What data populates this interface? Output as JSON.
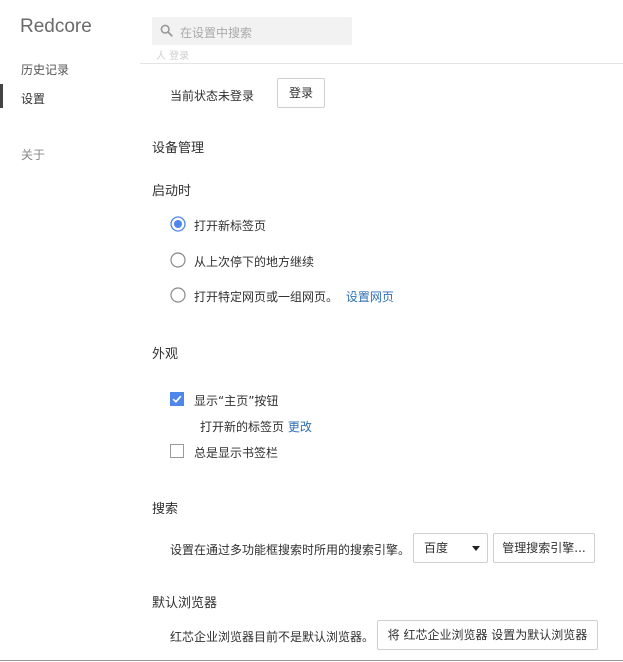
{
  "sidebar": {
    "brand": "Redcore",
    "items": [
      {
        "label": "历史记录"
      },
      {
        "label": "设置"
      },
      {
        "label": "关于"
      }
    ]
  },
  "search": {
    "placeholder": "在设置中搜索",
    "icon": "search-icon"
  },
  "ghost_label": "人 登录",
  "login": {
    "status": "当前状态未登录",
    "button": "登录"
  },
  "device": {
    "title": "设备管理"
  },
  "startup": {
    "title": "启动时",
    "options": [
      {
        "label": "打开新标签页",
        "selected": true
      },
      {
        "label": "从上次停下的地方继续",
        "selected": false
      },
      {
        "label": "打开特定网页或一组网页。",
        "selected": false,
        "link": "设置网页"
      }
    ]
  },
  "appearance": {
    "title": "外观",
    "show_home": {
      "label": "显示“主页”按钮",
      "checked": true
    },
    "home_sub": {
      "text": "打开新的标签页",
      "link": "更改"
    },
    "show_bookmarks": {
      "label": "总是显示书签栏",
      "checked": false
    }
  },
  "search_section": {
    "title": "搜索",
    "desc": "设置在通过多功能框搜索时所用的搜索引擎。",
    "engine": "百度",
    "manage": "管理搜索引擎..."
  },
  "default_browser": {
    "title": "默认浏览器",
    "desc": "红芯企业浏览器目前不是默认浏览器。",
    "button": "将 红芯企业浏览器 设置为默认浏览器"
  },
  "colors": {
    "accent": "#4f86ea",
    "link": "#2f6fb3"
  }
}
